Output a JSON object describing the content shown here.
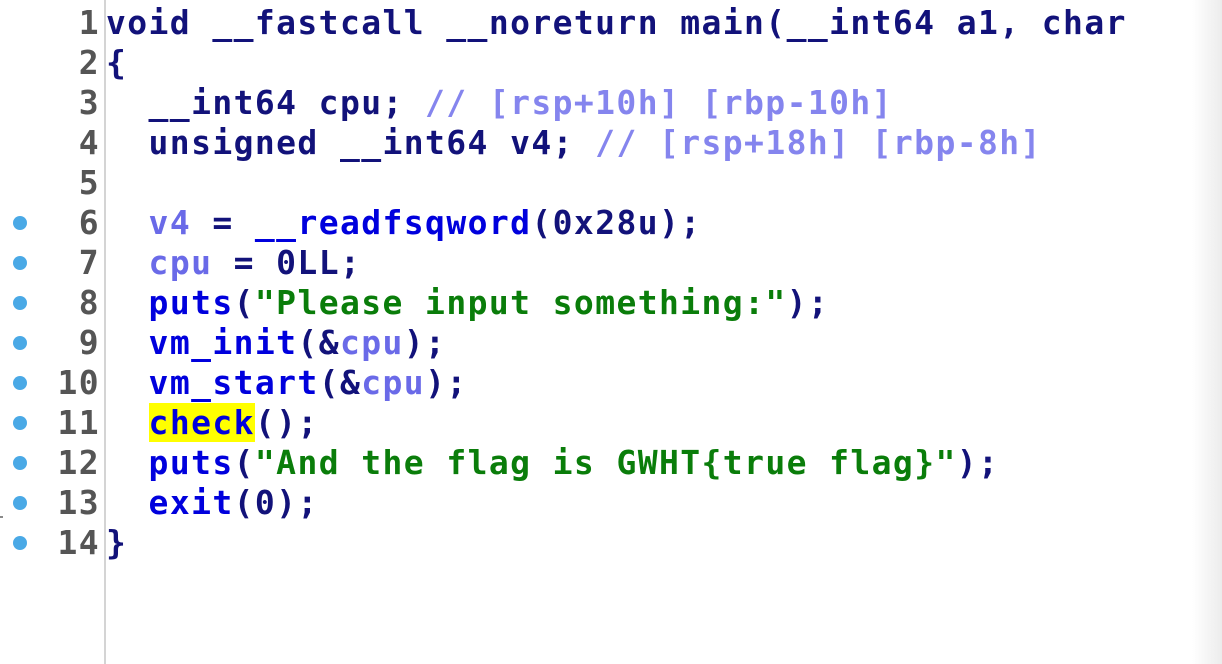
{
  "window": {
    "title": "",
    "line_count": 14
  },
  "colors": {
    "keyword": "#12127a",
    "function": "#0000dd",
    "variable": "#6a6ae8",
    "comment": "#8585ee",
    "string": "#0a7d0a",
    "highlight": "#ffff00",
    "breakpoint": "#4aa9e6",
    "line_number": "#555555"
  },
  "lines": [
    {
      "number": "1",
      "breakpoint": false,
      "tokens": [
        {
          "t": "void __fastcall __noreturn main(__int64 a1, char",
          "c": "kw"
        }
      ]
    },
    {
      "number": "2",
      "breakpoint": false,
      "tokens": [
        {
          "t": "{",
          "c": "kw"
        }
      ]
    },
    {
      "number": "3",
      "breakpoint": false,
      "tokens": [
        {
          "t": "  __int64 cpu; ",
          "c": "kw"
        },
        {
          "t": "// [rsp+10h] [rbp-10h]",
          "c": "cmt"
        }
      ]
    },
    {
      "number": "4",
      "breakpoint": false,
      "tokens": [
        {
          "t": "  unsigned __int64 v4; ",
          "c": "kw"
        },
        {
          "t": "// [rsp+18h] [rbp-8h]",
          "c": "cmt"
        }
      ]
    },
    {
      "number": "5",
      "breakpoint": false,
      "tokens": []
    },
    {
      "number": "6",
      "breakpoint": true,
      "tokens": [
        {
          "t": "  ",
          "c": "kw"
        },
        {
          "t": "v4",
          "c": "var"
        },
        {
          "t": " = ",
          "c": "kw"
        },
        {
          "t": "__readfsqword",
          "c": "fn"
        },
        {
          "t": "(0x28u);",
          "c": "kw"
        }
      ]
    },
    {
      "number": "7",
      "breakpoint": true,
      "tokens": [
        {
          "t": "  ",
          "c": "kw"
        },
        {
          "t": "cpu",
          "c": "var"
        },
        {
          "t": " = 0LL;",
          "c": "kw"
        }
      ]
    },
    {
      "number": "8",
      "breakpoint": true,
      "tokens": [
        {
          "t": "  ",
          "c": "kw"
        },
        {
          "t": "puts",
          "c": "fn"
        },
        {
          "t": "(",
          "c": "kw"
        },
        {
          "t": "\"Please input something:\"",
          "c": "str"
        },
        {
          "t": ");",
          "c": "kw"
        }
      ]
    },
    {
      "number": "9",
      "breakpoint": true,
      "tokens": [
        {
          "t": "  ",
          "c": "kw"
        },
        {
          "t": "vm_init",
          "c": "fn"
        },
        {
          "t": "(&",
          "c": "kw"
        },
        {
          "t": "cpu",
          "c": "var"
        },
        {
          "t": ");",
          "c": "kw"
        }
      ]
    },
    {
      "number": "10",
      "breakpoint": true,
      "tokens": [
        {
          "t": "  ",
          "c": "kw"
        },
        {
          "t": "vm_start",
          "c": "fn"
        },
        {
          "t": "(&",
          "c": "kw"
        },
        {
          "t": "cpu",
          "c": "var"
        },
        {
          "t": ");",
          "c": "kw"
        }
      ]
    },
    {
      "number": "11",
      "breakpoint": true,
      "tokens": [
        {
          "t": "  ",
          "c": "kw"
        },
        {
          "t": "check",
          "c": "hl"
        },
        {
          "t": "();",
          "c": "kw"
        }
      ]
    },
    {
      "number": "12",
      "breakpoint": true,
      "tokens": [
        {
          "t": "  ",
          "c": "kw"
        },
        {
          "t": "puts",
          "c": "fn"
        },
        {
          "t": "(",
          "c": "kw"
        },
        {
          "t": "\"And the flag is GWHT{true flag}\"",
          "c": "str"
        },
        {
          "t": ");",
          "c": "kw"
        }
      ]
    },
    {
      "number": "13",
      "breakpoint": true,
      "tokens": [
        {
          "t": "  ",
          "c": "kw"
        },
        {
          "t": "exit",
          "c": "fn"
        },
        {
          "t": "(0);",
          "c": "kw"
        }
      ]
    },
    {
      "number": "14",
      "breakpoint": true,
      "tokens": [
        {
          "t": "}",
          "c": "kw"
        }
      ]
    }
  ]
}
